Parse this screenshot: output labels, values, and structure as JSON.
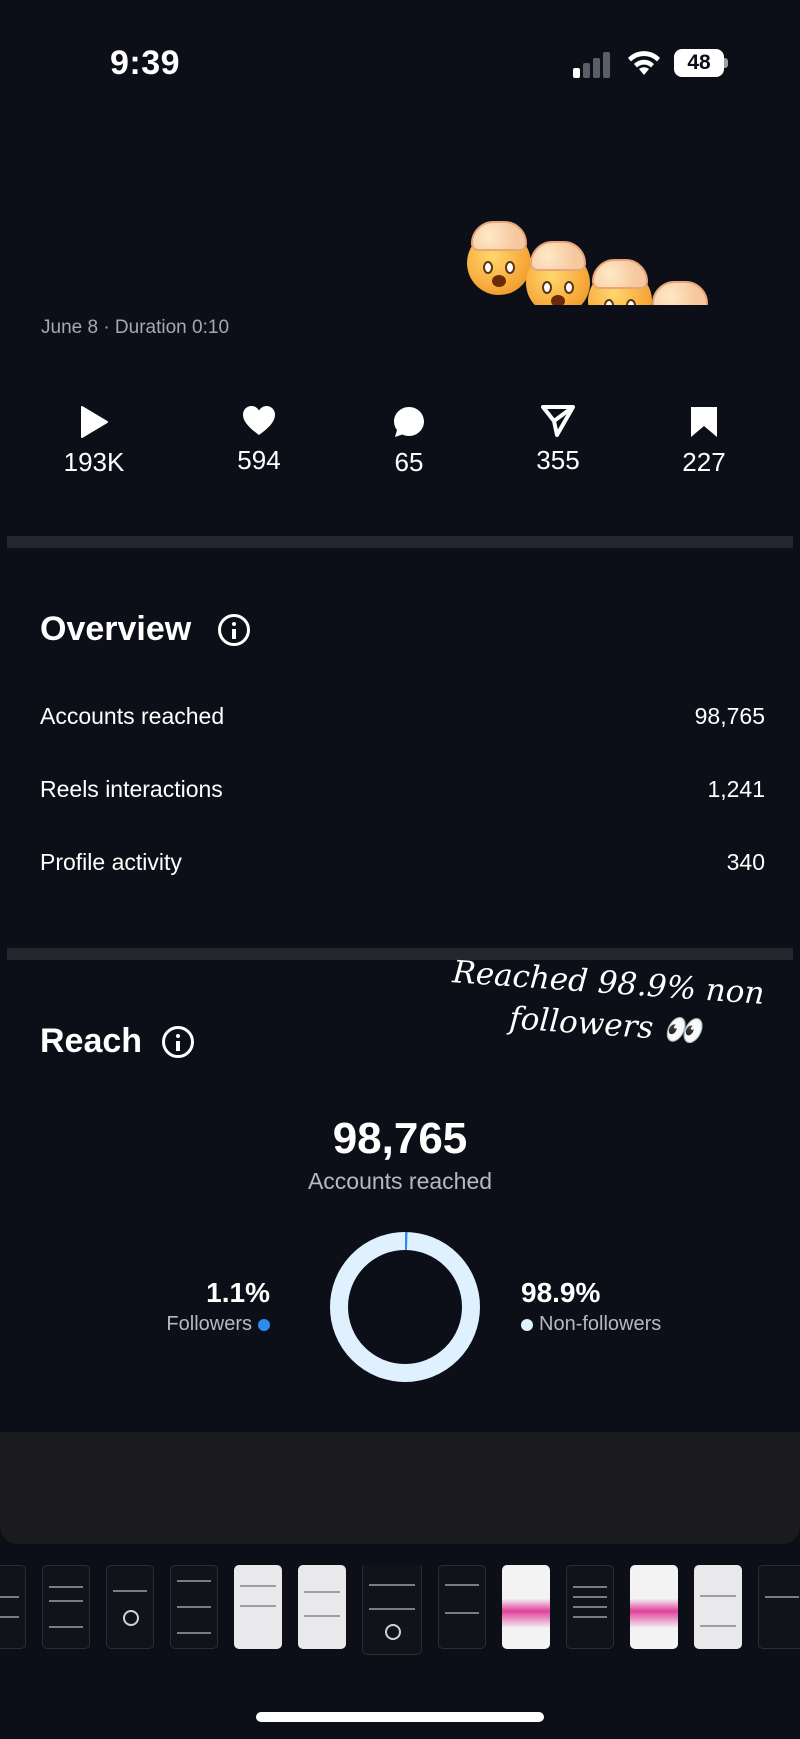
{
  "status_bar": {
    "time": "9:39",
    "battery": "48"
  },
  "post": {
    "meta": "June 8 · Duration 0:10",
    "stats": [
      {
        "icon": "play-icon",
        "value": "193K"
      },
      {
        "icon": "heart-icon",
        "value": "594"
      },
      {
        "icon": "comment-icon",
        "value": "65"
      },
      {
        "icon": "share-icon",
        "value": "355"
      },
      {
        "icon": "bookmark-icon",
        "value": "227"
      }
    ]
  },
  "overview": {
    "title": "Overview",
    "rows": [
      {
        "label": "Accounts reached",
        "value": "98,765"
      },
      {
        "label": "Reels interactions",
        "value": "1,241"
      },
      {
        "label": "Profile activity",
        "value": "340"
      }
    ]
  },
  "reach": {
    "title": "Reach",
    "annotation": "Reached 98.9% non followers 👀",
    "accounts_reached": "98,765",
    "accounts_reached_label": "Accounts reached",
    "followers_pct": "1.1%",
    "followers_label": "Followers",
    "non_followers_pct": "98.9%",
    "non_followers_label": "Non-followers",
    "followers_fraction": 0.011,
    "colors": {
      "followers": "#2d8cf0",
      "non_followers": "#dff0ff"
    }
  }
}
